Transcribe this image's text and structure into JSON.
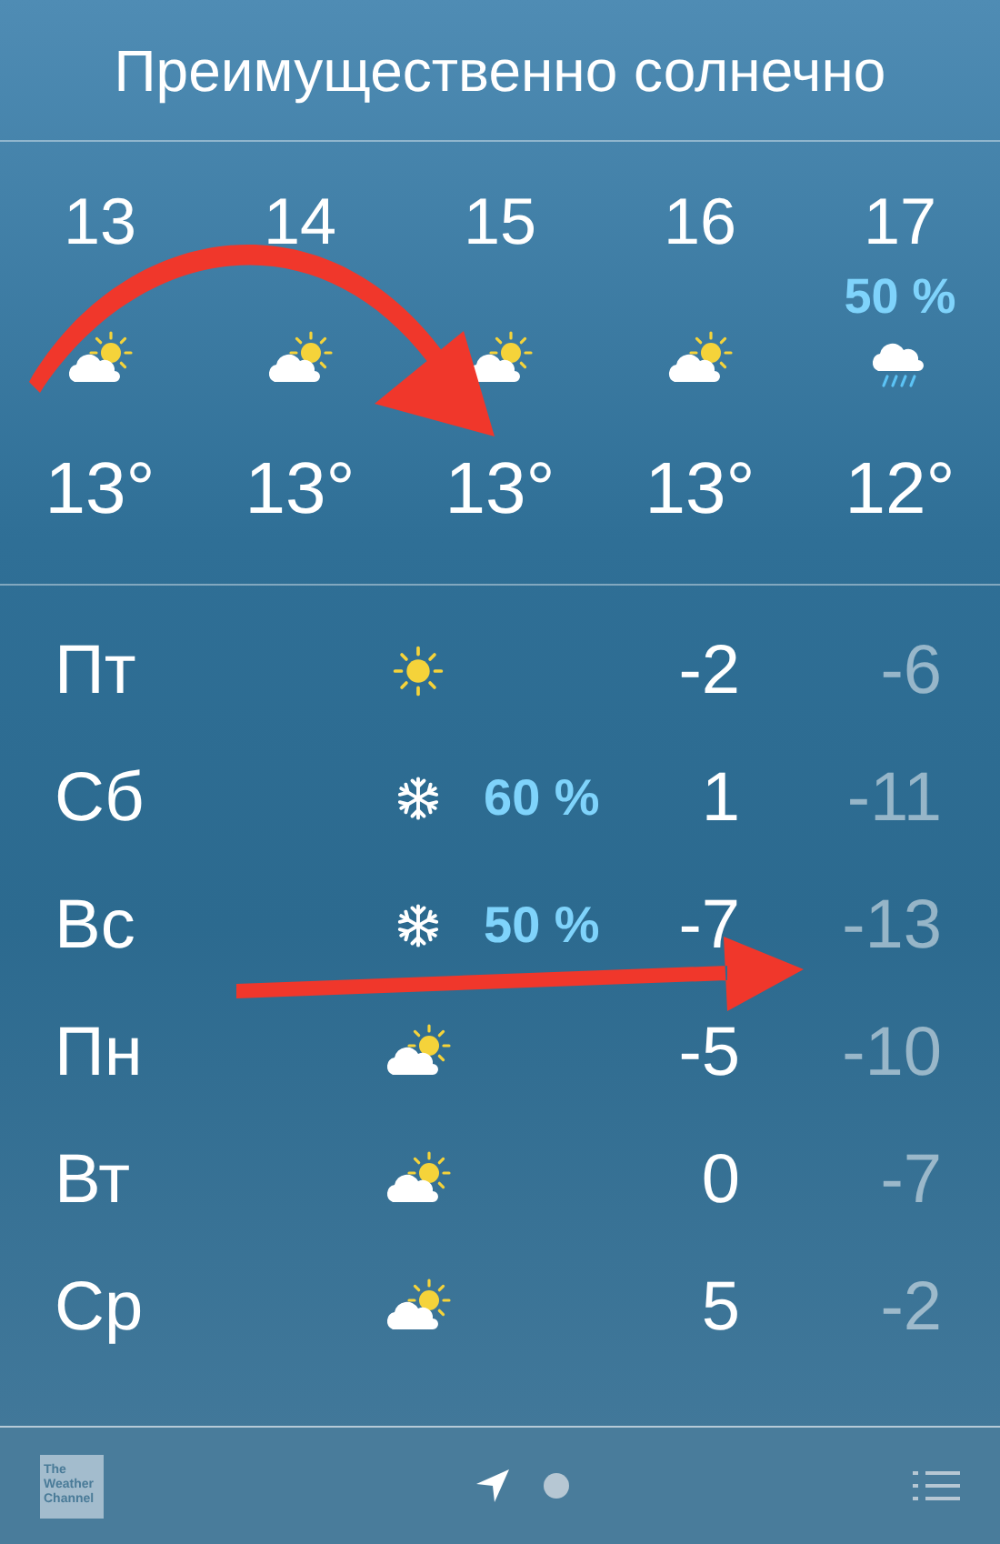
{
  "condition": "Преимущественно солнечно",
  "hourly": [
    {
      "hour": "13",
      "kind": "partly",
      "temp": "13°"
    },
    {
      "hour": "14",
      "kind": "partly",
      "temp": "13°"
    },
    {
      "hour": "15",
      "kind": "partly",
      "temp": "13°"
    },
    {
      "hour": "16",
      "kind": "partly",
      "temp": "13°"
    },
    {
      "hour": "17",
      "precip": "50 %",
      "kind": "rain",
      "temp": "12°"
    }
  ],
  "daily": [
    {
      "day": "Пт",
      "kind": "sun",
      "high": "-2",
      "low": "-6"
    },
    {
      "day": "Сб",
      "kind": "snow",
      "precip": "60 %",
      "high": "1",
      "low": "-11"
    },
    {
      "day": "Вс",
      "kind": "snow",
      "precip": "50 %",
      "high": "-7",
      "low": "-13"
    },
    {
      "day": "Пн",
      "kind": "partly",
      "high": "-5",
      "low": "-10"
    },
    {
      "day": "Вт",
      "kind": "partly",
      "high": "0",
      "low": "-7"
    },
    {
      "day": "Ср",
      "kind": "partly",
      "high": "5",
      "low": "-2"
    }
  ],
  "footer": {
    "logo": [
      "The",
      "Weather",
      "Channel"
    ],
    "pages": [
      {
        "kind": "location",
        "selected": true
      },
      {
        "kind": "dot",
        "selected": false
      }
    ]
  }
}
